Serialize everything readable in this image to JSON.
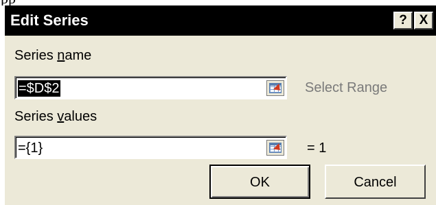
{
  "window": {
    "title": "Edit Series",
    "help_label": "?",
    "close_label": "X"
  },
  "series_name": {
    "label_prefix": "Series ",
    "label_hotkey": "n",
    "label_suffix": "ame",
    "value": "=$D$2",
    "range_icon": "collapse-dialog-icon",
    "hint": "Select Range"
  },
  "series_values": {
    "label_prefix": "Series ",
    "label_hotkey": "v",
    "label_suffix": "alues",
    "value": "={1}",
    "range_icon": "collapse-dialog-icon",
    "result": "= 1"
  },
  "buttons": {
    "ok": "OK",
    "cancel": "Cancel"
  },
  "colors": {
    "title_bar": "#000000",
    "dialog_face": "#ece9d8",
    "selection": "#000000",
    "hint_text": "#7a7a7a"
  }
}
